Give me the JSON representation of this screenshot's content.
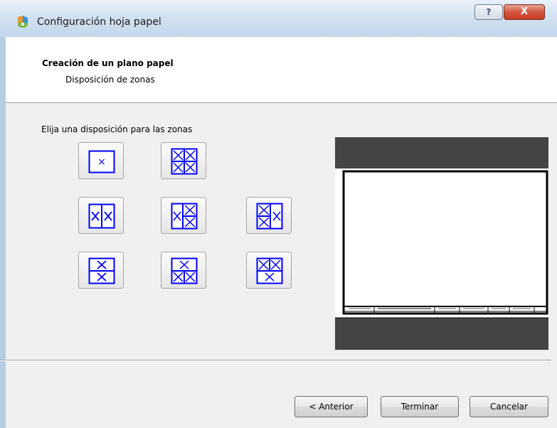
{
  "window": {
    "title": "Configuración hoja papel",
    "help_label": "?",
    "close_label": "X"
  },
  "header": {
    "title": "Creación de un plano papel",
    "subtitle": "Disposición de zonas"
  },
  "main": {
    "prompt": "Elija una disposición para las zonas",
    "layout_options": [
      {
        "name": "single"
      },
      {
        "name": "grid-2x2"
      },
      {
        "name": "two-columns"
      },
      {
        "name": "left-full-right-split"
      },
      {
        "name": "left-split-right-full"
      },
      {
        "name": "two-rows"
      },
      {
        "name": "top-full-bottom-split"
      },
      {
        "name": "top-split-bottom-full"
      }
    ]
  },
  "footer": {
    "back_label": "< Anterior",
    "finish_label": "Terminar",
    "cancel_label": "Cancelar"
  },
  "colors": {
    "layout_blue": "#0000ff",
    "preview_bg": "#444444"
  }
}
